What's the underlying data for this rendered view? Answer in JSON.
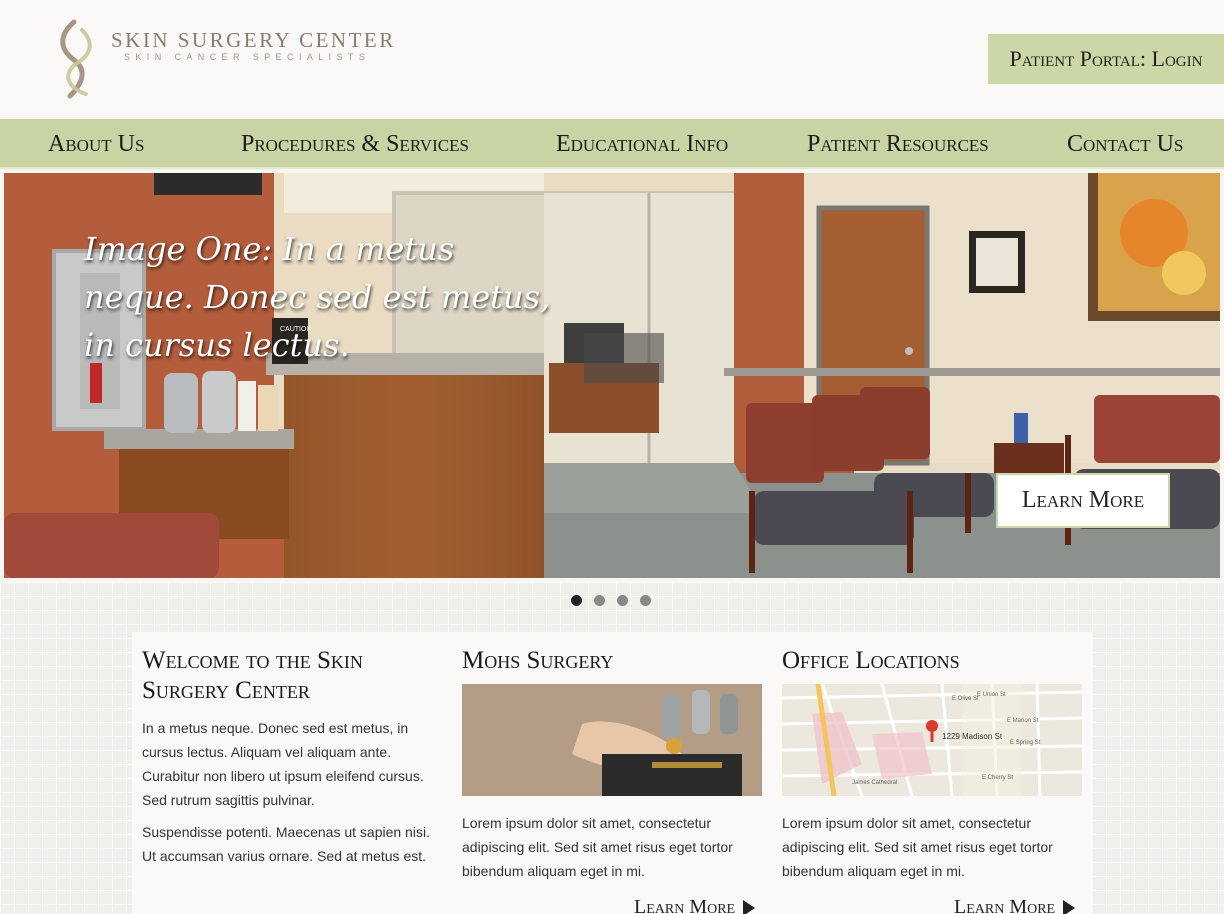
{
  "header": {
    "logo_title": "SKIN SURGERY CENTER",
    "logo_subtitle": "SKIN CANCER SPECIALISTS",
    "portal_label": "Patient Portal: Login"
  },
  "nav": {
    "items": [
      {
        "label": "About Us"
      },
      {
        "label": "Procedures & Services"
      },
      {
        "label": "Educational Info"
      },
      {
        "label": "Patient Resources"
      },
      {
        "label": "Contact Us"
      }
    ]
  },
  "hero": {
    "caption": "Image One: In a metus neque. Donec sed est metus, in cursus lectus.",
    "button_label": "Learn More",
    "caution_sign": "CAUTION",
    "slides_total": 4,
    "active_slide": 1
  },
  "columns": [
    {
      "title": "Welcome to the Skin Surgery Center",
      "paragraphs": [
        "In a metus neque. Donec sed est metus, in cursus lectus. Aliquam vel aliquam ante. Curabitur non libero ut ipsum eleifend cursus. Sed rutrum sagittis pulvinar.",
        "Suspendisse potenti. Maecenas ut sapien nisi. Ut accumsan varius ornare. Sed at metus est."
      ]
    },
    {
      "title": "Mohs Surgery",
      "text": "Lorem ipsum dolor sit amet, consectetur adipiscing elit. Sed sit amet risus eget tortor bibendum aliquam eget in mi.",
      "more_label": "Learn More"
    },
    {
      "title": "Office Locations",
      "text": "Lorem ipsum dolor sit amet, consectetur adipiscing elit. Sed sit amet risus eget tortor bibendum aliquam eget in mi.",
      "more_label": "Learn More",
      "map_pin_label": "1229 Madison St",
      "map_streets": [
        "E Union St",
        "E Olive St",
        "E Marion St",
        "E Spring St",
        "E Cherry St",
        "James Cathedral",
        "Madison St"
      ]
    }
  ],
  "colors": {
    "accent_green": "#ccd7a6",
    "nav_green": "#c8d4a4",
    "logo_brown": "#8a7b6f"
  }
}
